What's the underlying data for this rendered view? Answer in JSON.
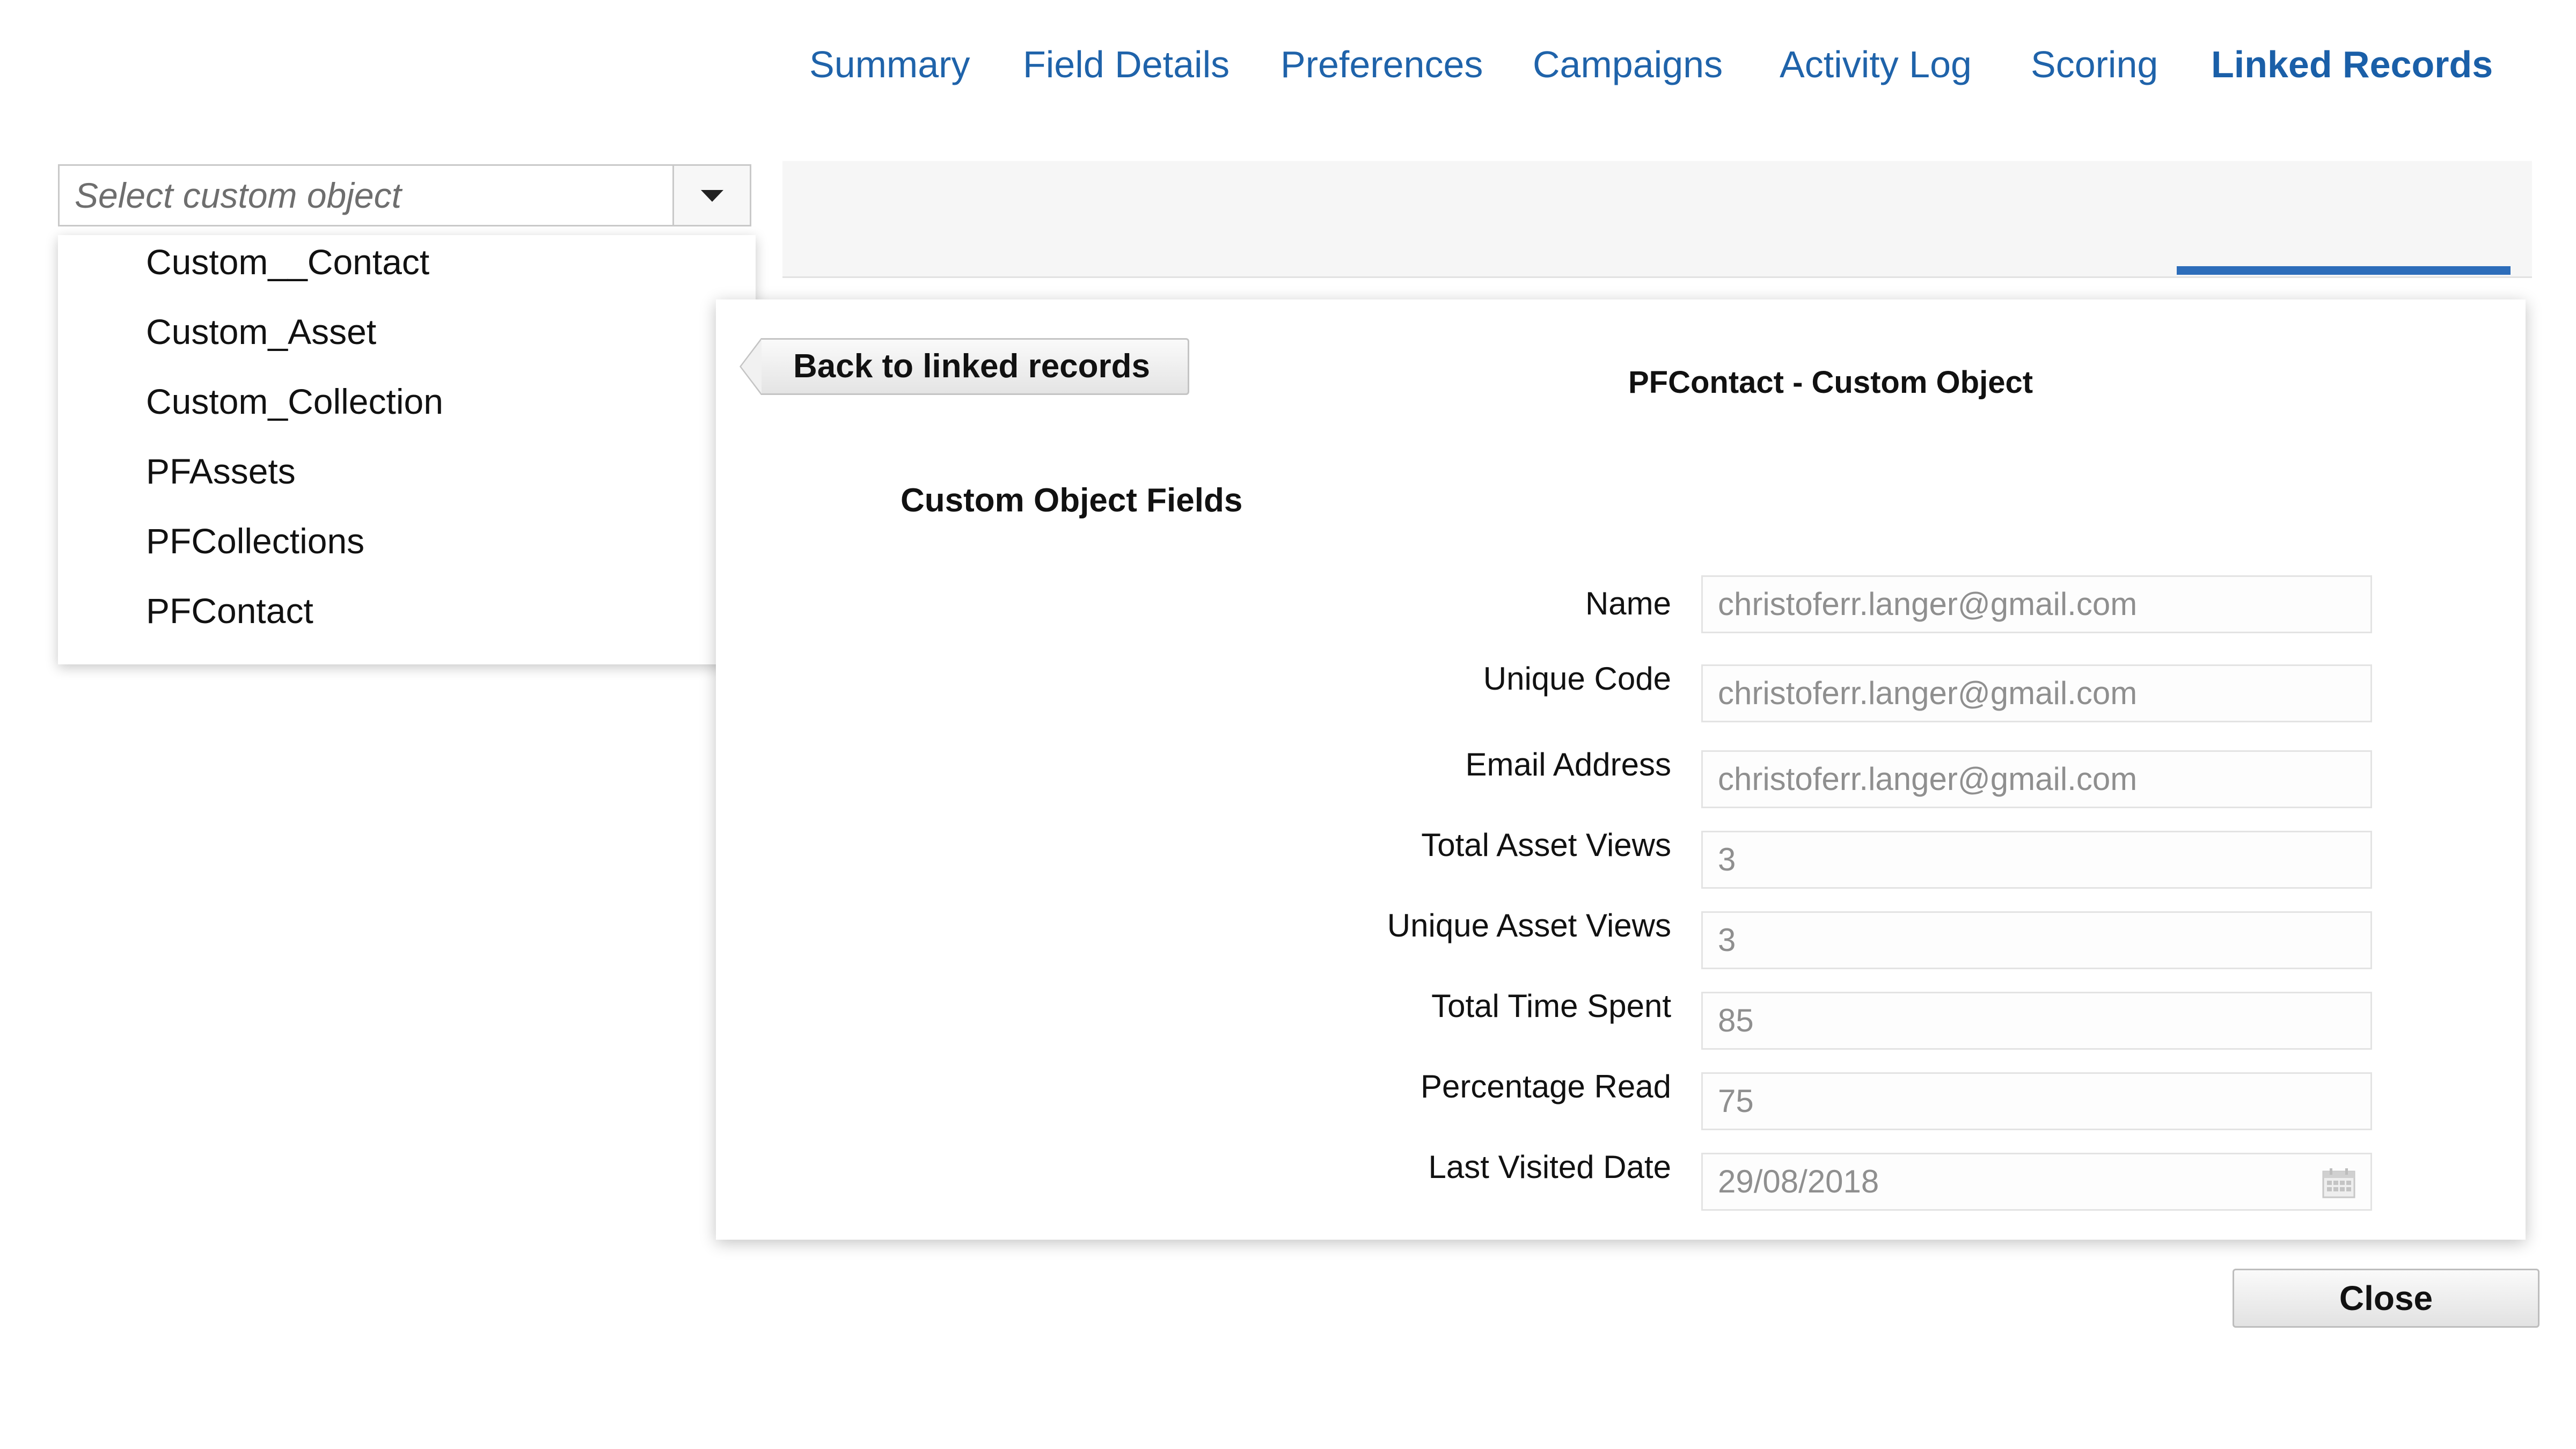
{
  "object_selector": {
    "placeholder": "Select custom object",
    "toggle_icon": "caret-down-icon",
    "options": [
      {
        "label": "Custom__Contact"
      },
      {
        "label": "Custom_Asset"
      },
      {
        "label": "Custom_Collection"
      },
      {
        "label": "PFAssets"
      },
      {
        "label": "PFCollections"
      },
      {
        "label": "PFContact"
      }
    ]
  },
  "tabs": [
    {
      "label": "Summary",
      "active": false
    },
    {
      "label": "Field Details",
      "active": false
    },
    {
      "label": "Preferences",
      "active": false
    },
    {
      "label": "Campaigns",
      "active": false
    },
    {
      "label": "Activity Log",
      "active": false
    },
    {
      "label": "Scoring",
      "active": false
    },
    {
      "label": "Linked Records",
      "active": true
    }
  ],
  "panel": {
    "back_label": "Back to linked records",
    "title": "PFContact - Custom Object",
    "section_title": "Custom Object Fields",
    "fields": [
      {
        "label": "Name",
        "value": "christoferr.langer@gmail.com"
      },
      {
        "label": "Unique Code",
        "value": "christoferr.langer@gmail.com"
      },
      {
        "label": "Email Address",
        "value": "christoferr.langer@gmail.com"
      },
      {
        "label": "Total Asset Views",
        "value": "3"
      },
      {
        "label": "Unique Asset Views",
        "value": "3"
      },
      {
        "label": "Total Time Spent",
        "value": "85"
      },
      {
        "label": "Percentage Read",
        "value": "75"
      },
      {
        "label": "Last Visited Date",
        "value": "29/08/2018",
        "icon": "calendar-icon"
      }
    ]
  },
  "footer": {
    "close_label": "Close"
  },
  "colors": {
    "tab_text": "#1f63aa",
    "tab_active_underline": "#2d6dba",
    "input_value_text": "#8f8f8f"
  }
}
